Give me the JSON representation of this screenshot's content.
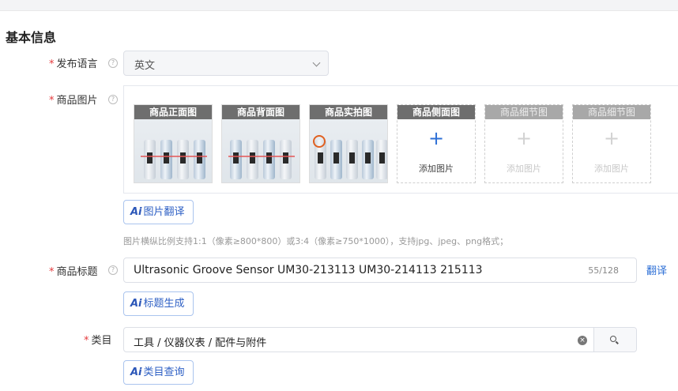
{
  "section": {
    "title": "基本信息"
  },
  "language": {
    "label": "发布语言",
    "value": "英文"
  },
  "images": {
    "label": "商品图片",
    "slots": [
      {
        "caption": "商品正面图",
        "state": "filled"
      },
      {
        "caption": "商品背面图",
        "state": "filled"
      },
      {
        "caption": "商品实拍图",
        "state": "filled"
      },
      {
        "caption": "商品侧面图",
        "state": "empty-active",
        "add_label": "添加图片"
      },
      {
        "caption": "商品细节图",
        "state": "empty-disabled",
        "add_label": "添加图片"
      },
      {
        "caption": "商品细节图",
        "state": "empty-disabled",
        "add_label": "添加图片"
      }
    ],
    "translate_button": {
      "ai": "Ai",
      "label": "图片翻译"
    },
    "hint": "图片横纵比例支持1:1（像素≥800*800）或3:4（像素≥750*1000），支持jpg、jpeg、png格式；"
  },
  "product_title": {
    "label": "商品标题",
    "value": "Ultrasonic Groove Sensor UM30-213113 UM30-214113 215113",
    "count": "55/128",
    "translate_link": "翻译",
    "generate_button": {
      "ai": "Ai",
      "label": "标题生成"
    }
  },
  "category": {
    "label": "类目",
    "value": "工具 / 仪器仪表 / 配件与附件",
    "query_button": {
      "ai": "Ai",
      "label": "类目查询"
    }
  },
  "colors": {
    "accent": "#2d6fd6",
    "required": "#e4393c",
    "ai_border": "#aac4ee"
  }
}
